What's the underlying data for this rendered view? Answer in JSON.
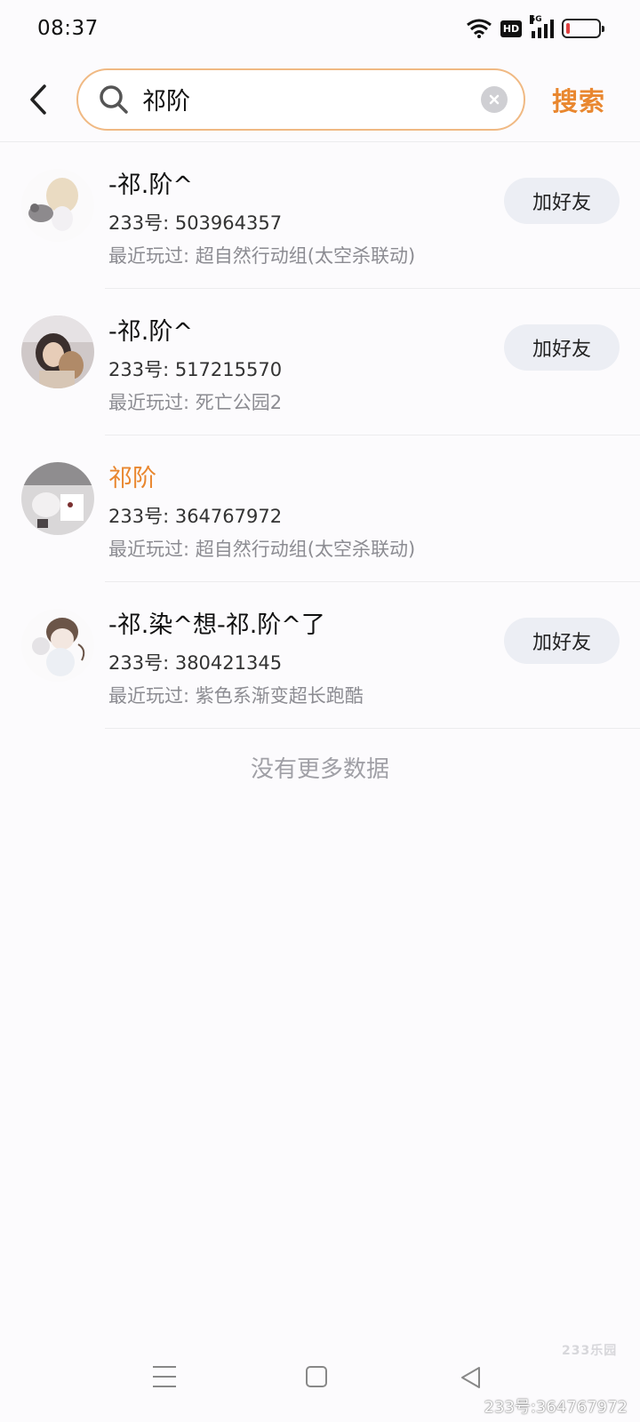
{
  "status_bar": {
    "time": "08:37",
    "network_badge": "HD",
    "network_type": "5G",
    "battery_color": "#e04040"
  },
  "search": {
    "query": "祁阶",
    "submit_label": "搜索",
    "accent": "#e9872f",
    "border_color": "#f0b983"
  },
  "results": [
    {
      "name": "-祁.阶^",
      "uid": "233号: 503964357",
      "recent": "最近玩过: 超自然行动组(太空杀联动)",
      "action": "加好友",
      "highlight": false
    },
    {
      "name": "-祁.阶^",
      "uid": "233号: 517215570",
      "recent": "最近玩过: 死亡公园2",
      "action": "加好友",
      "highlight": false
    },
    {
      "name": "祁阶",
      "uid": "233号: 364767972",
      "recent": "最近玩过: 超自然行动组(太空杀联动)",
      "action": "",
      "highlight": true
    },
    {
      "name": "-祁.染^想-祁.阶^了",
      "uid": "233号: 380421345",
      "recent": "最近玩过: 紫色系渐变超长跑酷",
      "action": "加好友",
      "highlight": false
    }
  ],
  "footer_text": "没有更多数据",
  "watermark": {
    "logo": "233乐园",
    "id_text": "233号:364767972"
  }
}
